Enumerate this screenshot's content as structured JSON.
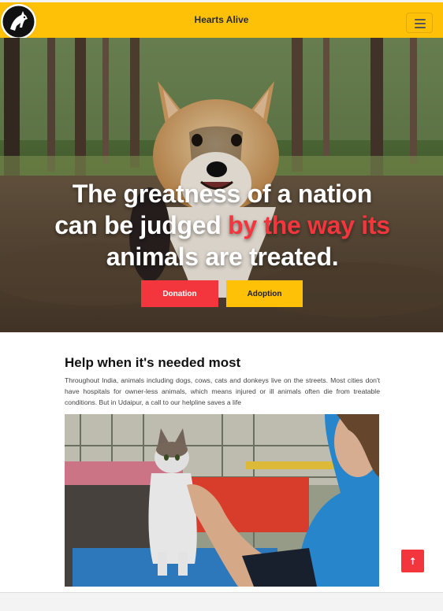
{
  "navbar": {
    "brand": "Hearts Alive",
    "logo_icon": "dog-silhouette-icon",
    "menu_icon": "hamburger-menu-icon",
    "background_color": "#fec107"
  },
  "hero": {
    "title_part1": "The greatness of a nation can be judged",
    "title_accent": "by the way its",
    "title_part2": "animals are treated.",
    "accent_color": "#f3363d",
    "buttons": {
      "donation": "Donation",
      "adoption": "Adoption"
    },
    "image": "corgi-dog-photo"
  },
  "help_section": {
    "title": "Help when it's needed most",
    "text": "Throughout India, animals including dogs, cows, cats and donkeys live on the streets. Most cities don't have hospitals for owner-less animals, which means injured or ill animals often die from treatable conditions. But in Udaipur, a call to our helpline saves a life",
    "image": "woman-petting-cat-photo"
  },
  "scroll_top": {
    "icon": "arrow-up-icon",
    "glyph": "↑"
  }
}
